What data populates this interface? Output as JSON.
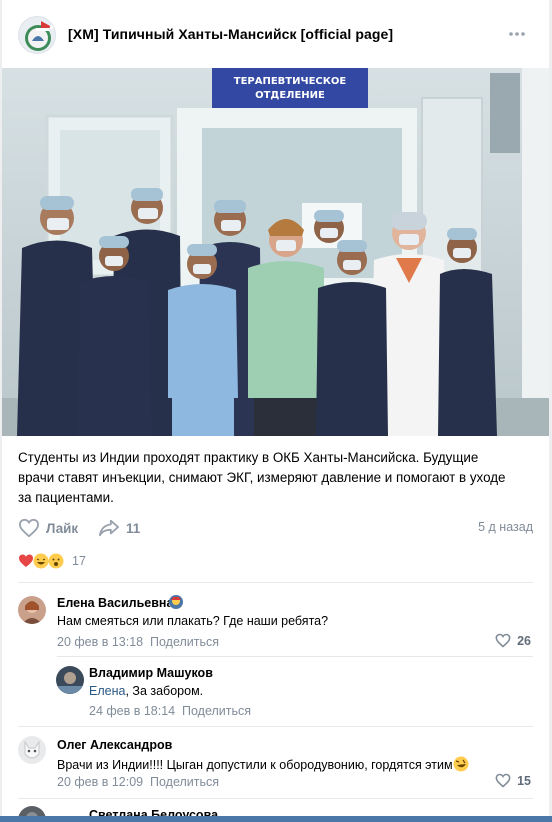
{
  "group": {
    "name": "[ХМ] Типичный Ханты-Мансийск [official page]"
  },
  "photo": {
    "sign": "ТЕРАПЕВТИЧЕСКОЕ\nОТДЕЛЕНИЕ",
    "sign_line1": "ТЕРАПЕВТИЧЕСКОЕ",
    "sign_line2": "ОТДЕЛЕНИЕ"
  },
  "post": {
    "text": "Студенты из Индии проходят практику в ОКБ Ханты-Мансийска. Будущие врачи ставят инъекции, снимают ЭКГ, измеряют давление и помогают в уходе за пациентами.",
    "like_label": "Лайк",
    "share_count": "11",
    "date": "5 д назад",
    "reactions_count": "17"
  },
  "comments": [
    {
      "author": "Елена Васильевна",
      "text": "Нам смеяться или плакать? Где наши ребята?",
      "date": "20 фев в 13:18",
      "share": "Поделиться",
      "likes": "26"
    },
    {
      "author": "Владимир Машуков",
      "reply_to": "Елена",
      "text": ", За забором.",
      "date": "24 фев в 18:14",
      "share": "Поделиться"
    },
    {
      "author": "Олег Александров",
      "text": "Врачи из Индии!!!! Цыган допустили к обородувонию, гордятся этим",
      "date": "20 фев в 12:09",
      "share": "Поделиться",
      "likes": "15"
    },
    {
      "author": "Светлана Белоусова"
    }
  ],
  "colors": {
    "accent": "#2a5885",
    "muted": "#818c99",
    "like_heart": "#e64646"
  }
}
